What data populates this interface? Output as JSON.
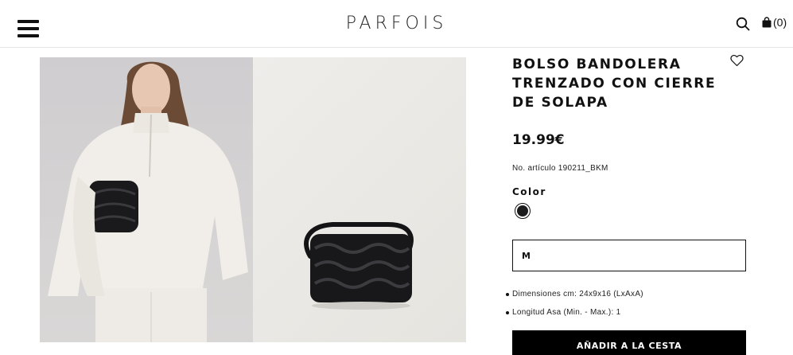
{
  "header": {
    "logo": "PARFOIS",
    "cart_count": "(0)",
    "icons": {
      "menu": "hamburger-menu-icon",
      "search": "search-icon",
      "cart": "shopping-bag-icon"
    }
  },
  "gallery": {
    "images": [
      {
        "name": "model-wearing-bag-photo"
      },
      {
        "name": "bag-product-photo"
      }
    ]
  },
  "product": {
    "title": "BOLSO BANDOLERA TRENZADO CON CIERRE DE SOLAPA",
    "price": "19.99€",
    "sku": "No. artículo 190211_BKM",
    "color_label": "Color",
    "color_swatch": "#1b1b1e",
    "size_value": "M",
    "specs": [
      "Dimensiones cm: 24x9x16 (LxAxA)",
      "Longitud Asa (Min. - Max.): 1"
    ],
    "add_to_cart": "AÑADIR A LA CESTA",
    "favorite_icon": "heart-icon"
  }
}
